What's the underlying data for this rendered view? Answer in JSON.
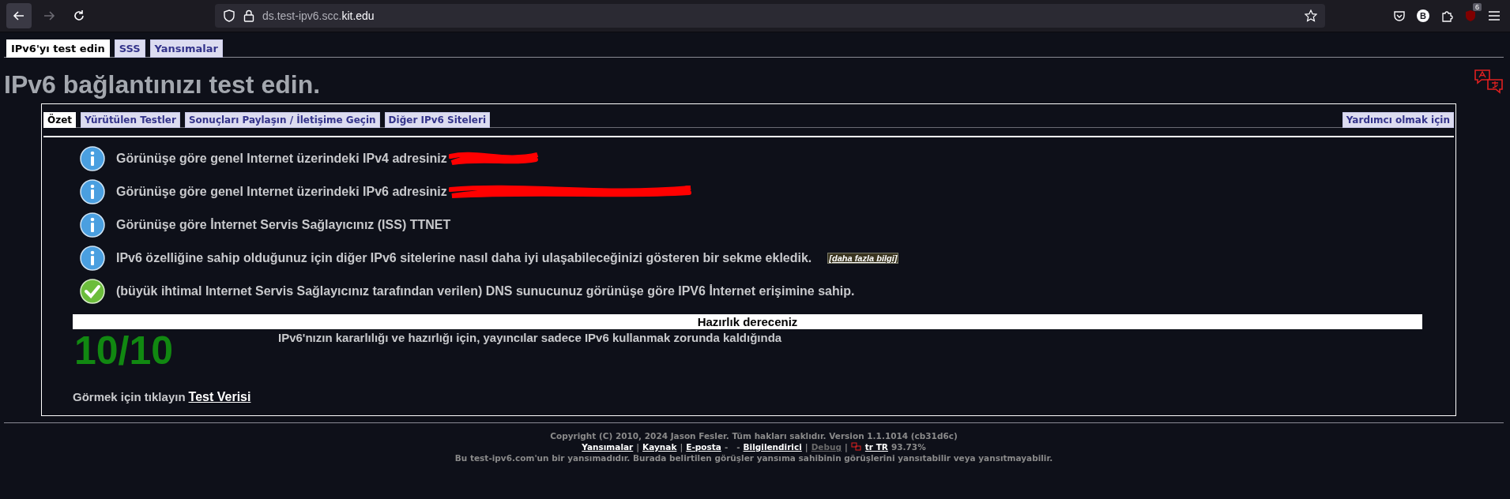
{
  "browser": {
    "url": {
      "subdomain": "ds.test-ipv6.scc.",
      "domain": "kit.edu"
    },
    "back_disabled": false,
    "forward_disabled": true,
    "profile_initial": "B",
    "extension_badge": "6"
  },
  "site_tabs": [
    {
      "label": "IPv6'yı test edin",
      "selected": true
    },
    {
      "label": "SSS",
      "selected": false
    },
    {
      "label": "Yansımalar",
      "selected": false
    }
  ],
  "heading": "IPv6 bağlantınızı test edin.",
  "panel_tabs": [
    {
      "label": "Özet",
      "selected": true
    },
    {
      "label": "Yürütülen Testler",
      "selected": false
    },
    {
      "label": "Sonuçları Paylaşın / İletişime Geçin",
      "selected": false
    },
    {
      "label": "Diğer IPv6 Siteleri",
      "selected": false
    }
  ],
  "panel_tab_right": {
    "label": "Yardımcı olmak için",
    "selected": false
  },
  "results": [
    {
      "kind": "info",
      "text": "Görünüşe göre genel Internet üzerindeki IPv4 adresiniz",
      "redacted": true
    },
    {
      "kind": "info",
      "text": "Görünüşe göre genel Internet üzerindeki IPv6 adresiniz",
      "redacted": true
    },
    {
      "kind": "info",
      "text": "Görünüşe göre İnternet Servis Sağlayıcınız (ISS) TTNET",
      "redacted": false
    },
    {
      "kind": "info",
      "text": "IPv6 özelliğine sahip olduğunuz için diğer IPv6 sitelerine nasıl daha iyi ulaşabileceğinizi gösteren bir sekme ekledik.",
      "link": "[daha fazla bilgi]",
      "redacted": false
    },
    {
      "kind": "ok",
      "text": "(büyük ihtimal Internet Servis Sağlayıcınız tarafından verilen) DNS sunucunuz görünüşe göre IPV6 İnternet erişimine sahip.",
      "redacted": false
    }
  ],
  "readiness": {
    "title": "Hazırlık dereceniz",
    "score": "10/10",
    "description": "IPv6'nızın kararlılığı ve hazırlığı için, yayıncılar sadece IPv6 kullanmak zorunda kaldığında"
  },
  "test_data": {
    "prompt": "Görmek için tıklayın",
    "link": "Test Verisi"
  },
  "footer": {
    "copyright": "Copyright (C) 2010, 2024 Jason Fesler. Tüm hakları saklıdır. Version 1.1.1014 (cb31d6c)",
    "links": [
      {
        "kind": "link",
        "text": "Yansımalar"
      },
      {
        "kind": "sep",
        "text": "|"
      },
      {
        "kind": "link",
        "text": "Kaynak"
      },
      {
        "kind": "sep",
        "text": "|"
      },
      {
        "kind": "link",
        "text": "E-posta"
      },
      {
        "kind": "sep",
        "text": "-   -"
      },
      {
        "kind": "link",
        "text": "Bilgilendirici"
      },
      {
        "kind": "sep",
        "text": "|"
      },
      {
        "kind": "muted",
        "text": "Debug"
      },
      {
        "kind": "sep",
        "text": "|"
      },
      {
        "kind": "locale",
        "text": "tr TR"
      },
      {
        "kind": "plain",
        "text": "93.73%"
      }
    ],
    "disclaimer": "Bu test-ipv6.com'un bir yansımadıdır. Burada belirtilen görüşler yansıma sahibinin görüşlerini yansıtabilir veya yansıtmayabilir."
  }
}
